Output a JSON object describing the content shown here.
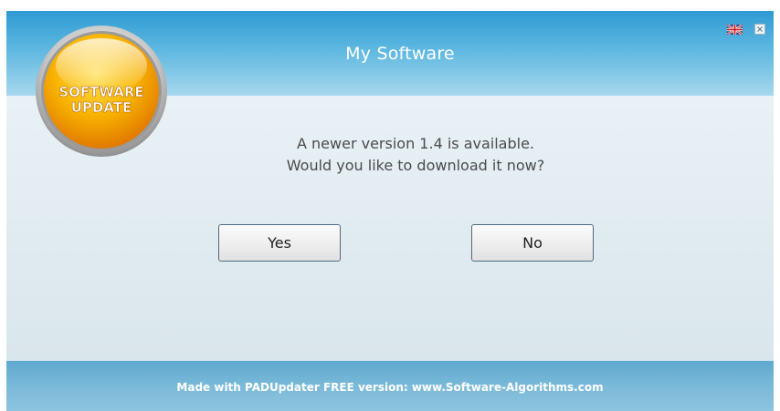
{
  "dialog": {
    "title": "My Software",
    "logo_text": [
      "SOFTWARE",
      "UPDATE"
    ],
    "message_line1": "A newer version 1.4 is available.",
    "message_line2": "Would you like to download it now?",
    "yes_label": "Yes",
    "no_label": "No",
    "footer": "Made with PADUpdater FREE version:  www.Software-Algorithms.com",
    "icons": [
      "uk-flag-icon",
      "close-icon"
    ]
  },
  "colors": {
    "header_blue": "#2f9bd3",
    "footer_blue": "#6cb3d6",
    "logo_orange": "#f5a300"
  }
}
